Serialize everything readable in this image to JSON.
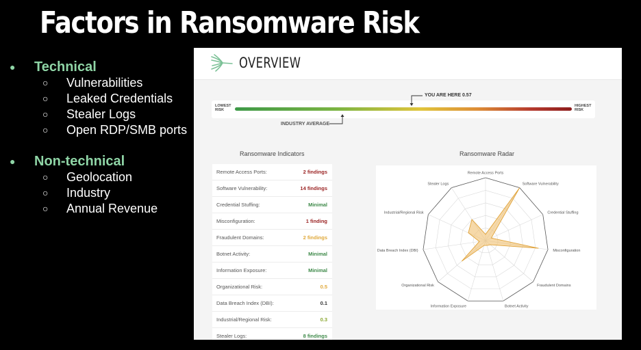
{
  "slide": {
    "title": "Factors in Ransomware Risk",
    "bullets": [
      {
        "label": "Technical",
        "items": [
          "Vulnerabilities",
          "Leaked Credentials",
          "Stealer Logs",
          "Open RDP/SMB ports"
        ]
      },
      {
        "label": "Non-technical",
        "items": [
          "Geolocation",
          "Industry",
          "Annual Revenue"
        ]
      }
    ],
    "bullet_marker": "●",
    "sub_marker": "○"
  },
  "overview": {
    "title": "OVERVIEW",
    "scale": {
      "low": "LOWEST RISK",
      "high": "HIGHEST RISK",
      "you_are_here_label": "YOU ARE HERE 0.57",
      "score": 0.57,
      "industry_label": "INDUSTRY AVERAGE"
    },
    "indicators_title": "Ransomware Indicators",
    "radar_title": "Ransomware Radar",
    "indicators": [
      {
        "label": "Remote Access Ports:",
        "value": "2 findings",
        "color": "#9b2424"
      },
      {
        "label": "Software Vulnerability:",
        "value": "14 findings",
        "color": "#9b2424"
      },
      {
        "label": "Credential Stuffing:",
        "value": "Minimal",
        "color": "#3f8a4a"
      },
      {
        "label": "Misconfiguration:",
        "value": "1 finding",
        "color": "#9b2424"
      },
      {
        "label": "Fraudulent Domains:",
        "value": "2 findings",
        "color": "#e0a93b"
      },
      {
        "label": "Botnet Activity:",
        "value": "Minimal",
        "color": "#3f8a4a"
      },
      {
        "label": "Information Exposure:",
        "value": "Minimal",
        "color": "#3f8a4a"
      },
      {
        "label": "Organizational Risk:",
        "value": "0.5",
        "color": "#e0a93b"
      },
      {
        "label": "Data Breach Index (DBI):",
        "value": "0.1",
        "color": "#333333"
      },
      {
        "label": "Industrial/Regional Risk:",
        "value": "0.3",
        "color": "#8aa832"
      },
      {
        "label": "Stealer Logs:",
        "value": "8 findings",
        "color": "#3f8a4a"
      }
    ],
    "radar": {
      "axes": [
        "Remote Access Ports",
        "Software Vulnerability",
        "Credential Stuffing",
        "Misconfiguration",
        "Fraudulent Domains",
        "Botnet Activity",
        "Information Exposure",
        "Organizational Risk",
        "Data Breach Index (DBI)",
        "Industrial/Regional Risk",
        "Stealer Logs"
      ],
      "values": [
        0.1,
        1.0,
        0.1,
        0.85,
        0.1,
        0.08,
        0.08,
        0.5,
        0.1,
        0.3,
        0.4
      ],
      "fill_color": "#f0c070",
      "stroke_color": "#e0a33a"
    }
  }
}
